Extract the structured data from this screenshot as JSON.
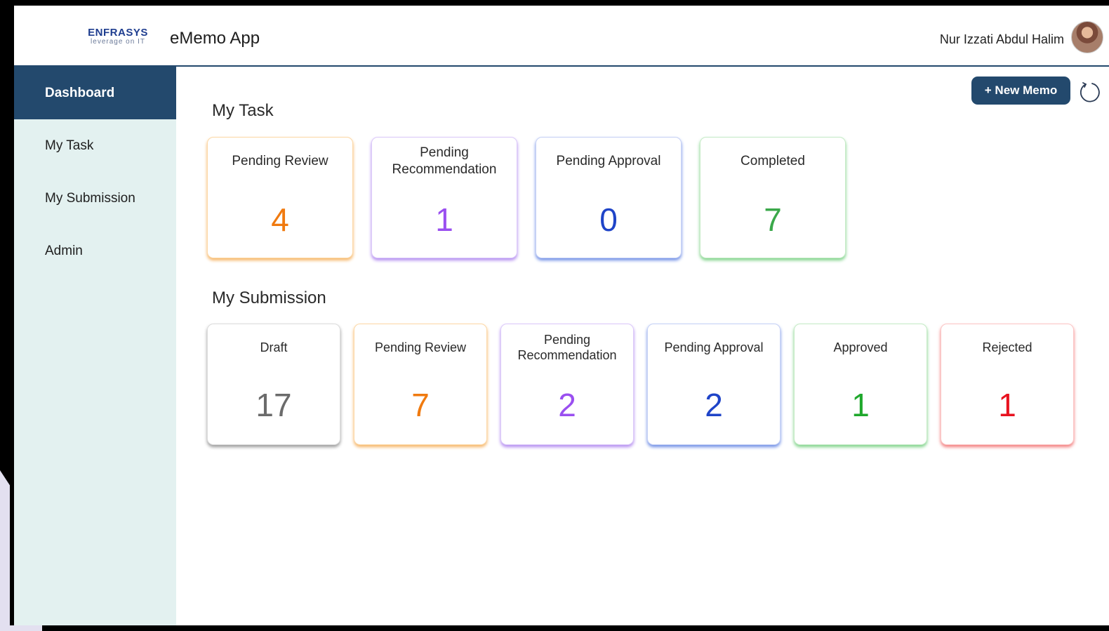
{
  "header": {
    "logo_main": "ENFRASYS",
    "logo_tagline": "leverage on IT",
    "app_title": "eMemo App",
    "user_name": "Nur Izzati Abdul Halim"
  },
  "sidebar": {
    "items": [
      {
        "label": "Dashboard",
        "active": true
      },
      {
        "label": "My Task",
        "active": false
      },
      {
        "label": "My Submission",
        "active": false
      },
      {
        "label": "Admin",
        "active": false
      }
    ]
  },
  "toolbar": {
    "new_memo_label": "+ New Memo",
    "refresh_icon": "refresh-icon"
  },
  "my_task": {
    "title": "My Task",
    "cards": [
      {
        "label": "Pending Review",
        "value": "4",
        "color": "#f07a0f"
      },
      {
        "label": "Pending Recommendation",
        "value": "1",
        "color": "#9a4ff0"
      },
      {
        "label": "Pending Approval",
        "value": "0",
        "color": "#1f44c8"
      },
      {
        "label": "Completed",
        "value": "7",
        "color": "#3aa84a"
      }
    ]
  },
  "my_submission": {
    "title": "My Submission",
    "cards": [
      {
        "label": "Draft",
        "value": "17",
        "color": "#6b6b6b"
      },
      {
        "label": "Pending Review",
        "value": "7",
        "color": "#f07a0f"
      },
      {
        "label": "Pending Recommendation",
        "value": "2",
        "color": "#9a4ff0"
      },
      {
        "label": "Pending Approval",
        "value": "2",
        "color": "#1f44c8"
      },
      {
        "label": "Approved",
        "value": "1",
        "color": "#1fa82c"
      },
      {
        "label": "Rejected",
        "value": "1",
        "color": "#e8121f"
      }
    ]
  }
}
